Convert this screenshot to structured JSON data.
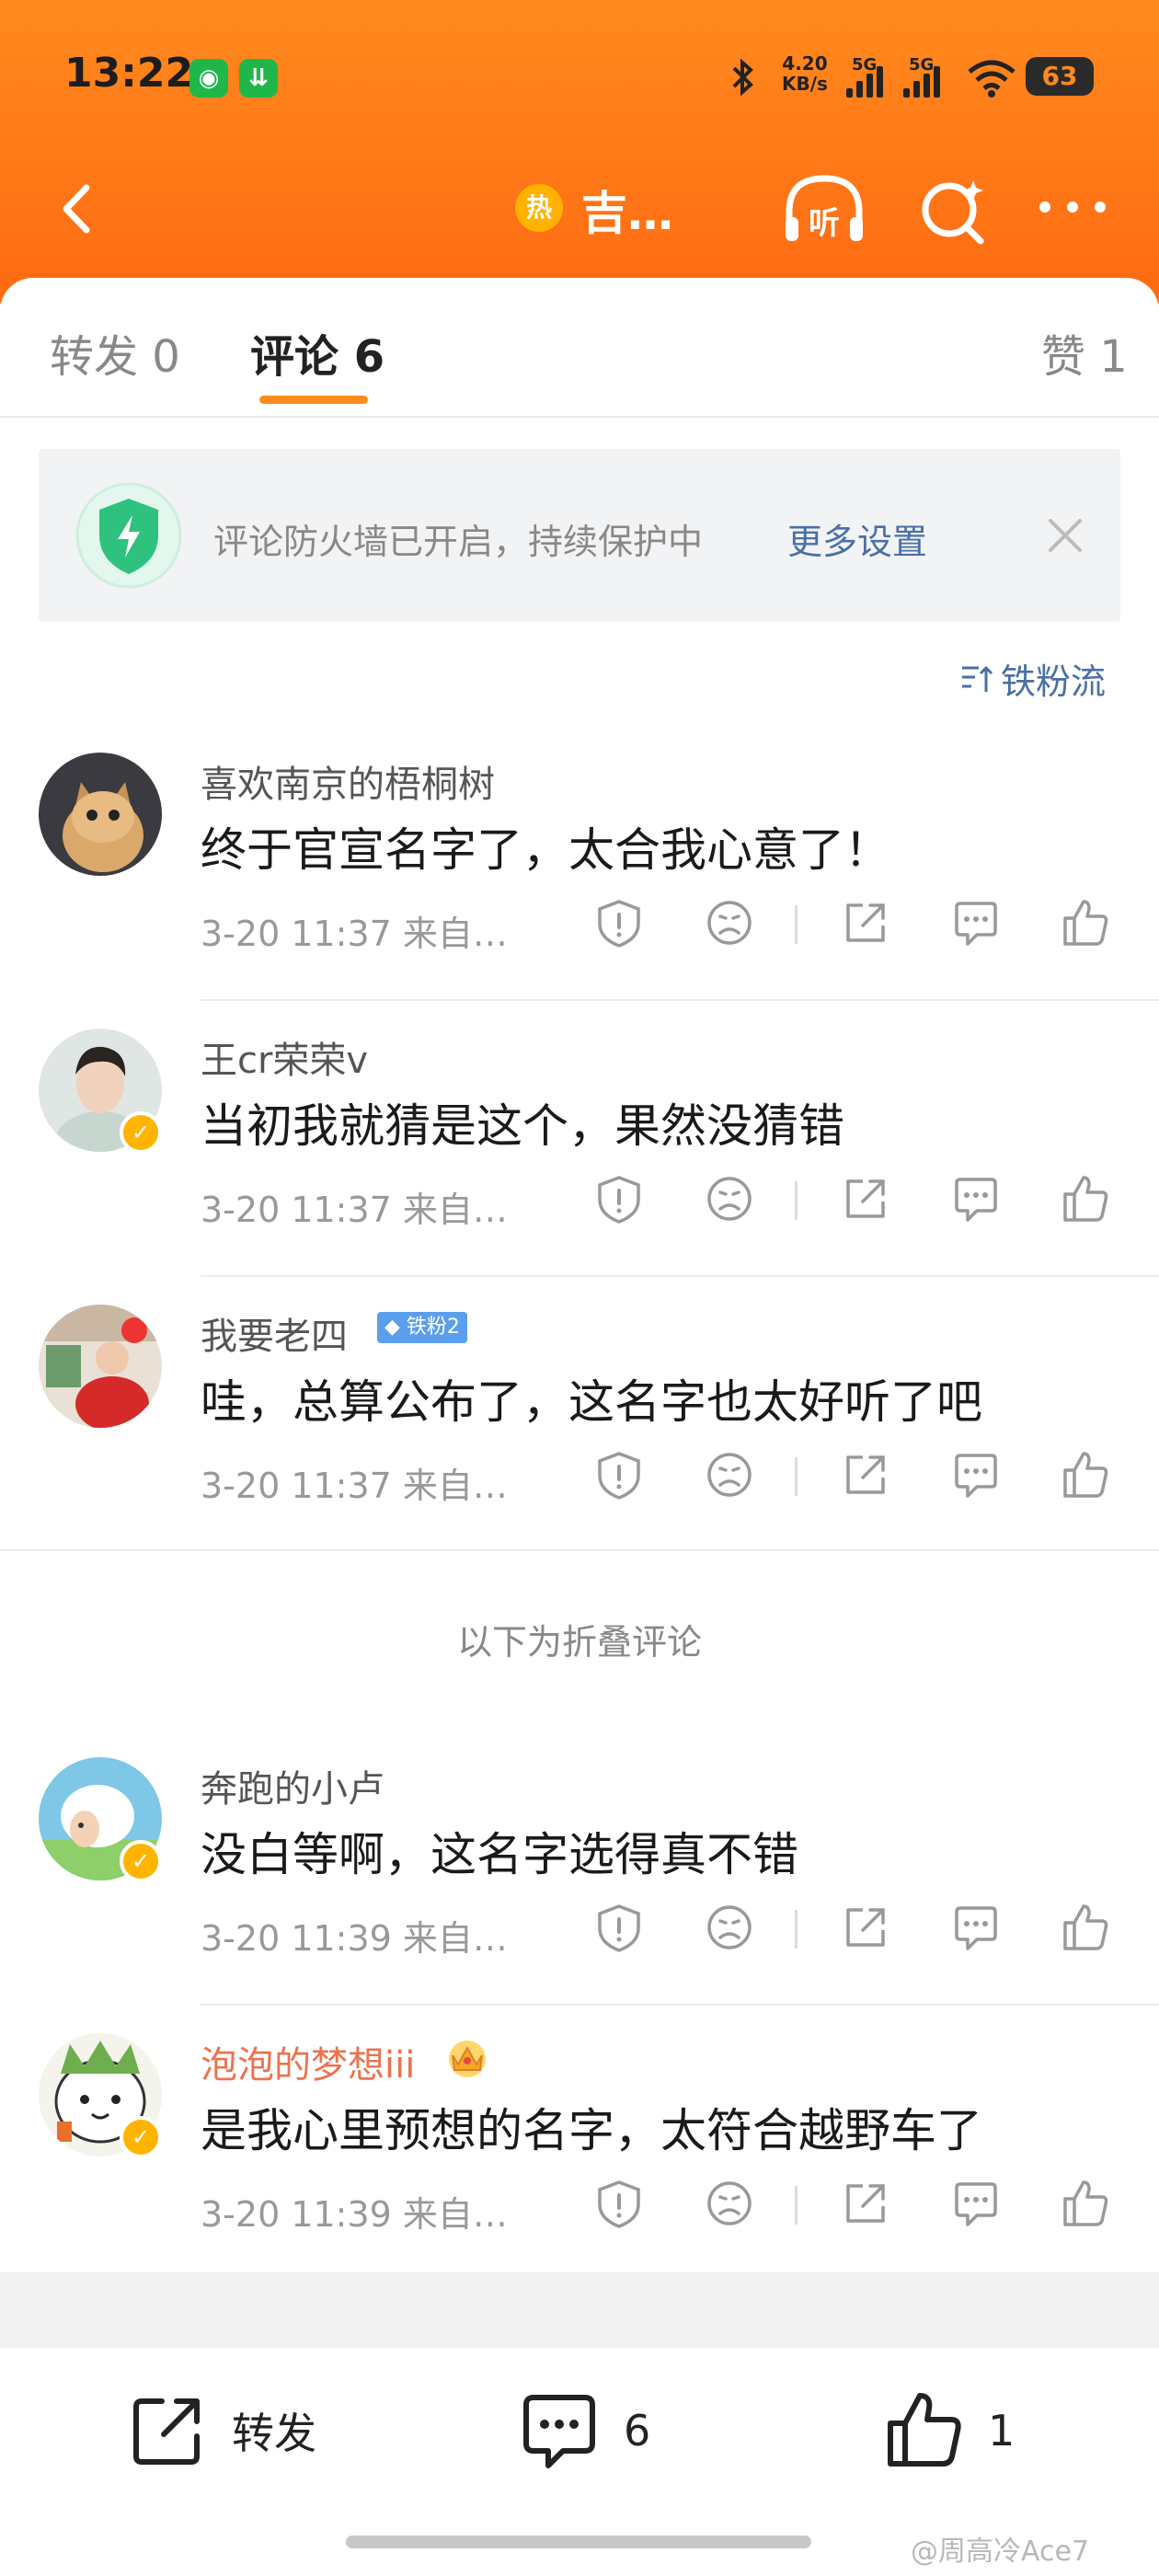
{
  "status": {
    "time": "13:22",
    "net_speed_top": "4.20",
    "net_speed_bottom": "KB/s",
    "sim1": "5G",
    "sim2": "5G",
    "battery": "63"
  },
  "nav": {
    "hot_label": "热",
    "title": "吉…"
  },
  "tabs": [
    {
      "label": "转发 0"
    },
    {
      "label": "评论 6"
    },
    {
      "label": "赞 1"
    }
  ],
  "firewall": {
    "text": "评论防火墙已开启，持续保护中",
    "link": "更多设置"
  },
  "sort_label": "铁粉流",
  "comments": [
    {
      "user": "喜欢南京的梧桐树",
      "text": "终于官宣名字了，太合我心意了！",
      "meta": "3-20 11:37  来自…",
      "verified": false
    },
    {
      "user": "王cr荣荣v",
      "text": "当初我就猜是这个，果然没猜错",
      "meta": "3-20 11:37  来自…",
      "verified": true
    },
    {
      "user": "我要老四",
      "badge": "铁粉2",
      "text": "哇，总算公布了，这名字也太好听了吧",
      "meta": "3-20 11:37  来自…",
      "verified": false
    },
    {
      "user": "奔跑的小卢",
      "text": "没白等啊，这名字选得真不错",
      "meta": "3-20 11:39  来自…",
      "verified": true
    },
    {
      "user": "泡泡的梦想iii",
      "text": "是我心里预想的名字，太符合越野车了",
      "meta": "3-20 11:39  来自…",
      "verified": true
    }
  ],
  "fold_label": "以下为折叠评论",
  "bottombar": {
    "share": "转发",
    "comment": "6",
    "like": "1"
  },
  "watermark": "@周高冷Ace7",
  "colors": {
    "header": "#ff7a18",
    "accent": "#ff8a1e",
    "link": "#4a6fa5"
  }
}
